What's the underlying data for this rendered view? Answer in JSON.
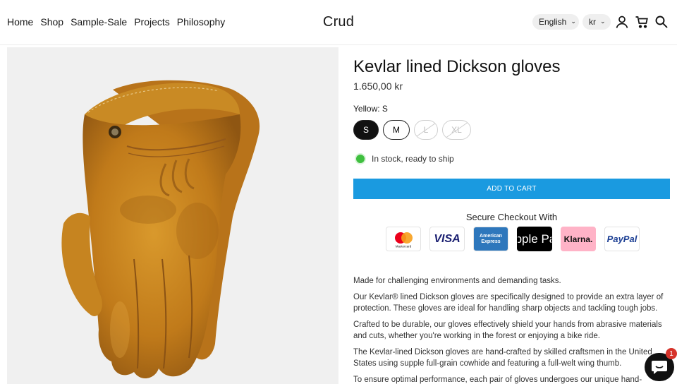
{
  "header": {
    "nav": [
      "Home",
      "Shop",
      "Sample-Sale",
      "Projects",
      "Philosophy"
    ],
    "logo": "Crud",
    "language": "English",
    "currency": "kr",
    "icons": [
      "account-icon",
      "cart-icon",
      "search-icon"
    ]
  },
  "product": {
    "title": "Kevlar lined Dickson gloves",
    "price": "1.650,00 kr",
    "variant_label": "Yellow: S",
    "sizes": [
      {
        "label": "S",
        "state": "selected"
      },
      {
        "label": "M",
        "state": "available"
      },
      {
        "label": "L",
        "state": "unavailable"
      },
      {
        "label": "XL",
        "state": "unavailable"
      }
    ],
    "stock_text": "In stock, ready to ship",
    "add_to_cart": "ADD TO CART",
    "secure_checkout": "Secure Checkout With",
    "payment_methods": [
      "Mastercard",
      "VISA",
      "American Express",
      "Apple Pay",
      "Klarna.",
      "PayPal"
    ],
    "description": [
      "Made for challenging environments and demanding tasks.",
      "Our Kevlar® lined Dickson gloves are specifically designed to provide an extra layer of protection. These gloves are ideal for handling sharp objects and tackling tough jobs.",
      "Crafted to be durable, our gloves effectively shield your hands from abrasive materials and cuts, whether you're working in the forest or enjoying a bike ride.",
      "The Kevlar-lined Dickson gloves are hand-crafted by skilled craftsmen in the United States using supple full-grain cowhide and featuring a full-welt wing thumb.",
      "To ensure optimal performance, each pair of gloves undergoes our unique hand-finishing"
    ]
  },
  "chat": {
    "badge": "1"
  },
  "colors": {
    "accent": "#1a9ae0",
    "stock": "#3fbf3f",
    "badge": "#d6332a",
    "glove": "#c8861e"
  }
}
